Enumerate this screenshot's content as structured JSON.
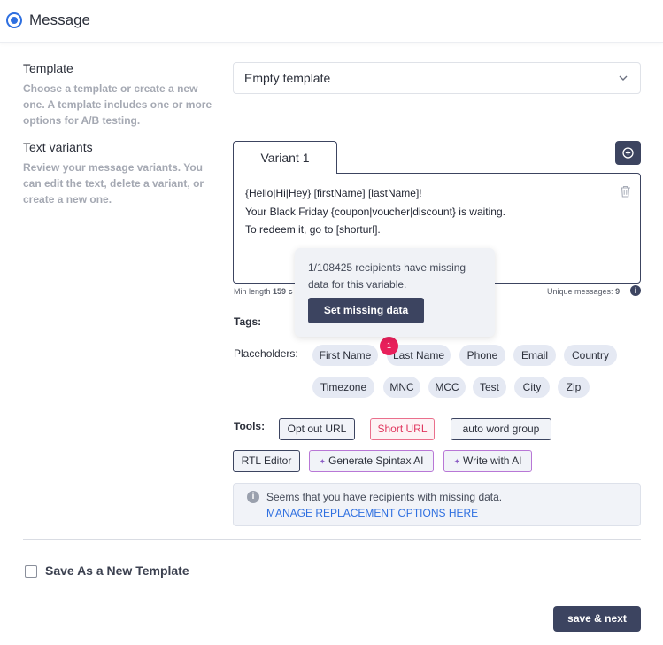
{
  "header": {
    "title": "Message"
  },
  "template": {
    "label": "Template",
    "description": "Choose a template or create a new one. A template includes one or more options for A/B testing.",
    "selected": "Empty template"
  },
  "text_variants": {
    "label": "Text variants",
    "description": "Review your message variants. You can edit the text, delete a variant, or create a new one.",
    "tab_label": "Variant 1",
    "lines": [
      "{Hello|Hi|Hey} [firstName] [lastName]!",
      "Your Black Friday {coupon|voucher|discount} is waiting.",
      "To redeem it, go to [shorturl]."
    ],
    "min_length_label": "Min length",
    "min_length_value": "159 c",
    "unique_label": "Unique messages:",
    "unique_value": "9"
  },
  "tooltip": {
    "text": "1/108425 recipients have missing data for this variable.",
    "button": "Set missing data"
  },
  "tags": {
    "label": "Tags:",
    "placeholders_label": "Placeholders:",
    "badge_count": "1",
    "placeholders": [
      "First Name",
      "Last Name",
      "Phone",
      "Email",
      "Country",
      "Timezone",
      "MNC",
      "MCC",
      "Test",
      "City",
      "Zip"
    ]
  },
  "tools": {
    "label": "Tools:",
    "items": [
      "Opt out URL",
      "Short URL",
      "auto word group",
      "RTL Editor",
      "Generate Spintax AI",
      "Write with AI"
    ]
  },
  "alert": {
    "text": "Seems that you have recipients with missing data.",
    "link": "MANAGE REPLACEMENT OPTIONS HERE"
  },
  "footer": {
    "save_template_label": "Save As a New Template",
    "next_button": "save & next"
  },
  "colors": {
    "accent": "#2e6fe0",
    "primary_dark": "#3c4460",
    "badge": "#e8205b",
    "short_url": "#e0365e"
  }
}
